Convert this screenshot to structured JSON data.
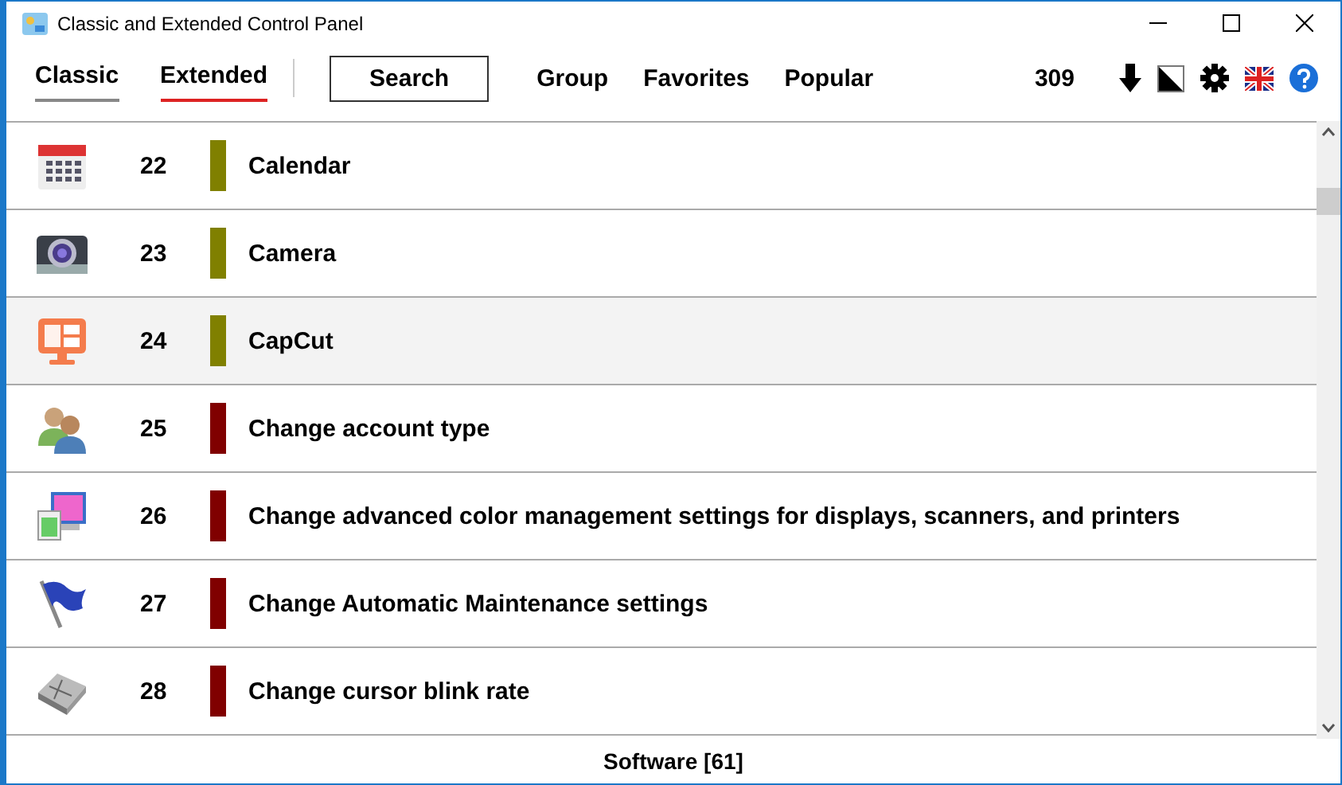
{
  "window": {
    "title": "Classic and Extended Control Panel"
  },
  "tabs": [
    {
      "label": "Classic",
      "selected": false
    },
    {
      "label": "Extended",
      "selected": true
    }
  ],
  "search_button": "Search",
  "links": [
    "Group",
    "Favorites",
    "Popular"
  ],
  "count": "309",
  "items": [
    {
      "number": "22",
      "label": "Calendar",
      "color": "#808000",
      "selected": false
    },
    {
      "number": "23",
      "label": "Camera",
      "color": "#808000",
      "selected": false
    },
    {
      "number": "24",
      "label": "CapCut",
      "color": "#808000",
      "selected": true
    },
    {
      "number": "25",
      "label": "Change account type",
      "color": "#800000",
      "selected": false
    },
    {
      "number": "26",
      "label": "Change advanced color management settings for displays, scanners, and printers",
      "color": "#800000",
      "selected": false
    },
    {
      "number": "27",
      "label": "Change Automatic Maintenance settings",
      "color": "#800000",
      "selected": false
    },
    {
      "number": "28",
      "label": "Change cursor blink rate",
      "color": "#800000",
      "selected": false
    }
  ],
  "status_bar": "Software [61]"
}
